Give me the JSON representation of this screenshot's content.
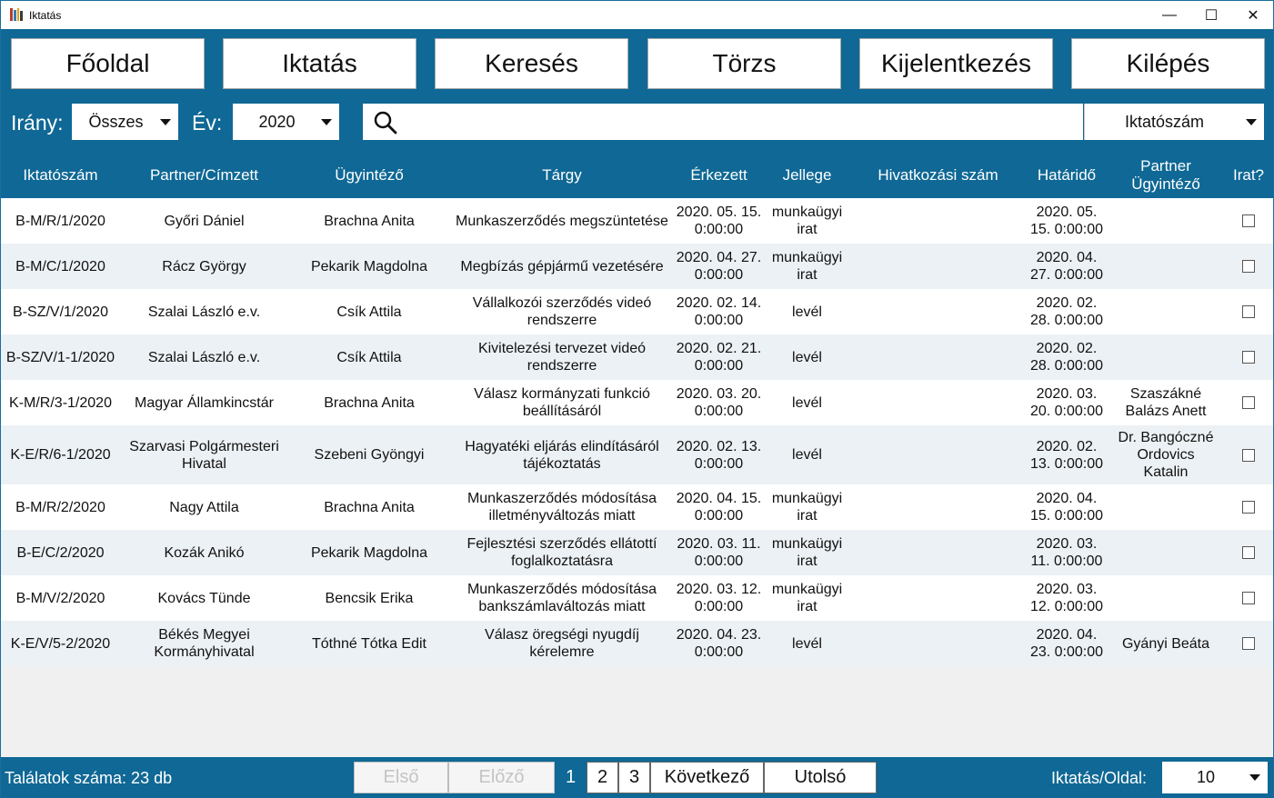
{
  "window": {
    "title": "Iktatás",
    "minimize": "—",
    "maximize": "☐",
    "close": "✕"
  },
  "nav": {
    "home": "Főoldal",
    "iktatas": "Iktatás",
    "kereses": "Keresés",
    "torzs": "Törzs",
    "kijelentkezes": "Kijelentkezés",
    "kilepes": "Kilépés"
  },
  "filters": {
    "irany_label": "Irány:",
    "irany_value": "Összes",
    "ev_label": "Év:",
    "ev_value": "2020",
    "search_placeholder": "",
    "search_field_value": "Iktatószám"
  },
  "columns": [
    "Iktatószám",
    "Partner/Címzett",
    "Ügyintéző",
    "Tárgy",
    "Érkezett",
    "Jellege",
    "Hivatkozási szám",
    "Határidő",
    "Partner Ügyintéző",
    "Irat?"
  ],
  "rows": [
    [
      "B-M/R/1/2020",
      "Győri Dániel",
      "Brachna Anita",
      "Munkaszerződés megszüntetése",
      "2020. 05. 15. 0:00:00",
      "munkaügyi irat",
      "",
      "2020. 05. 15. 0:00:00",
      "",
      ""
    ],
    [
      "B-M/C/1/2020",
      "Rácz György",
      "Pekarik Magdolna",
      "Megbízás gépjármű vezetésére",
      "2020. 04. 27. 0:00:00",
      "munkaügyi irat",
      "",
      "2020. 04. 27. 0:00:00",
      "",
      ""
    ],
    [
      "B-SZ/V/1/2020",
      "Szalai László e.v.",
      "Csík Attila",
      "Vállalkozói szerződés videó rendszerre",
      "2020. 02. 14. 0:00:00",
      "levél",
      "",
      "2020. 02. 28. 0:00:00",
      "",
      ""
    ],
    [
      "B-SZ/V/1-1/2020",
      "Szalai László e.v.",
      "Csík Attila",
      "Kivitelezési tervezet videó rendszerre",
      "2020. 02. 21. 0:00:00",
      "levél",
      "",
      "2020. 02. 28. 0:00:00",
      "",
      ""
    ],
    [
      "K-M/R/3-1/2020",
      "Magyar Államkincstár",
      "Brachna Anita",
      "Válasz kormányzati funkció beállításáról",
      "2020. 03. 20. 0:00:00",
      "levél",
      "",
      "2020. 03. 20. 0:00:00",
      "Szaszákné Balázs Anett",
      ""
    ],
    [
      "K-E/R/6-1/2020",
      "Szarvasi Polgármesteri Hivatal",
      "Szebeni Gyöngyi",
      "Hagyatéki eljárás elindításáról tájékoztatás",
      "2020. 02. 13. 0:00:00",
      "levél",
      "",
      "2020. 02. 13. 0:00:00",
      "Dr. Bangóczné Ordovics Katalin",
      ""
    ],
    [
      "B-M/R/2/2020",
      "Nagy Attila",
      "Brachna Anita",
      "Munkaszerződés módosítása illetményváltozás miatt",
      "2020. 04. 15. 0:00:00",
      "munkaügyi irat",
      "",
      "2020. 04. 15. 0:00:00",
      "",
      ""
    ],
    [
      "B-E/C/2/2020",
      "Kozák Anikó",
      "Pekarik Magdolna",
      "Fejlesztési szerződés ellátottí foglalkoztatásra",
      "2020. 03. 11. 0:00:00",
      "munkaügyi irat",
      "",
      "2020. 03. 11. 0:00:00",
      "",
      ""
    ],
    [
      "B-M/V/2/2020",
      "Kovács Tünde",
      "Bencsik Erika",
      "Munkaszerződés módosítása bankszámlaváltozás miatt",
      "2020. 03. 12. 0:00:00",
      "munkaügyi irat",
      "",
      "2020. 03. 12. 0:00:00",
      "",
      ""
    ],
    [
      "K-E/V/5-2/2020",
      "Békés Megyei Kormányhivatal",
      "Tóthné Tótka Edit",
      "Válasz öregségi nyugdíj kérelemre",
      "2020. 04. 23. 0:00:00",
      "levél",
      "",
      "2020. 04. 23. 0:00:00",
      "Gyányi Beáta",
      ""
    ]
  ],
  "footer": {
    "count_label": "Találatok száma: 23 db",
    "first": "Első",
    "prev": "Előző",
    "pages": [
      "1",
      "2",
      "3"
    ],
    "next": "Következő",
    "last": "Utolsó",
    "per_page_label": "Iktatás/Oldal:",
    "per_page_value": "10"
  },
  "colors": {
    "brand": "#0f6895",
    "row_alt": "#ecf1f5"
  }
}
